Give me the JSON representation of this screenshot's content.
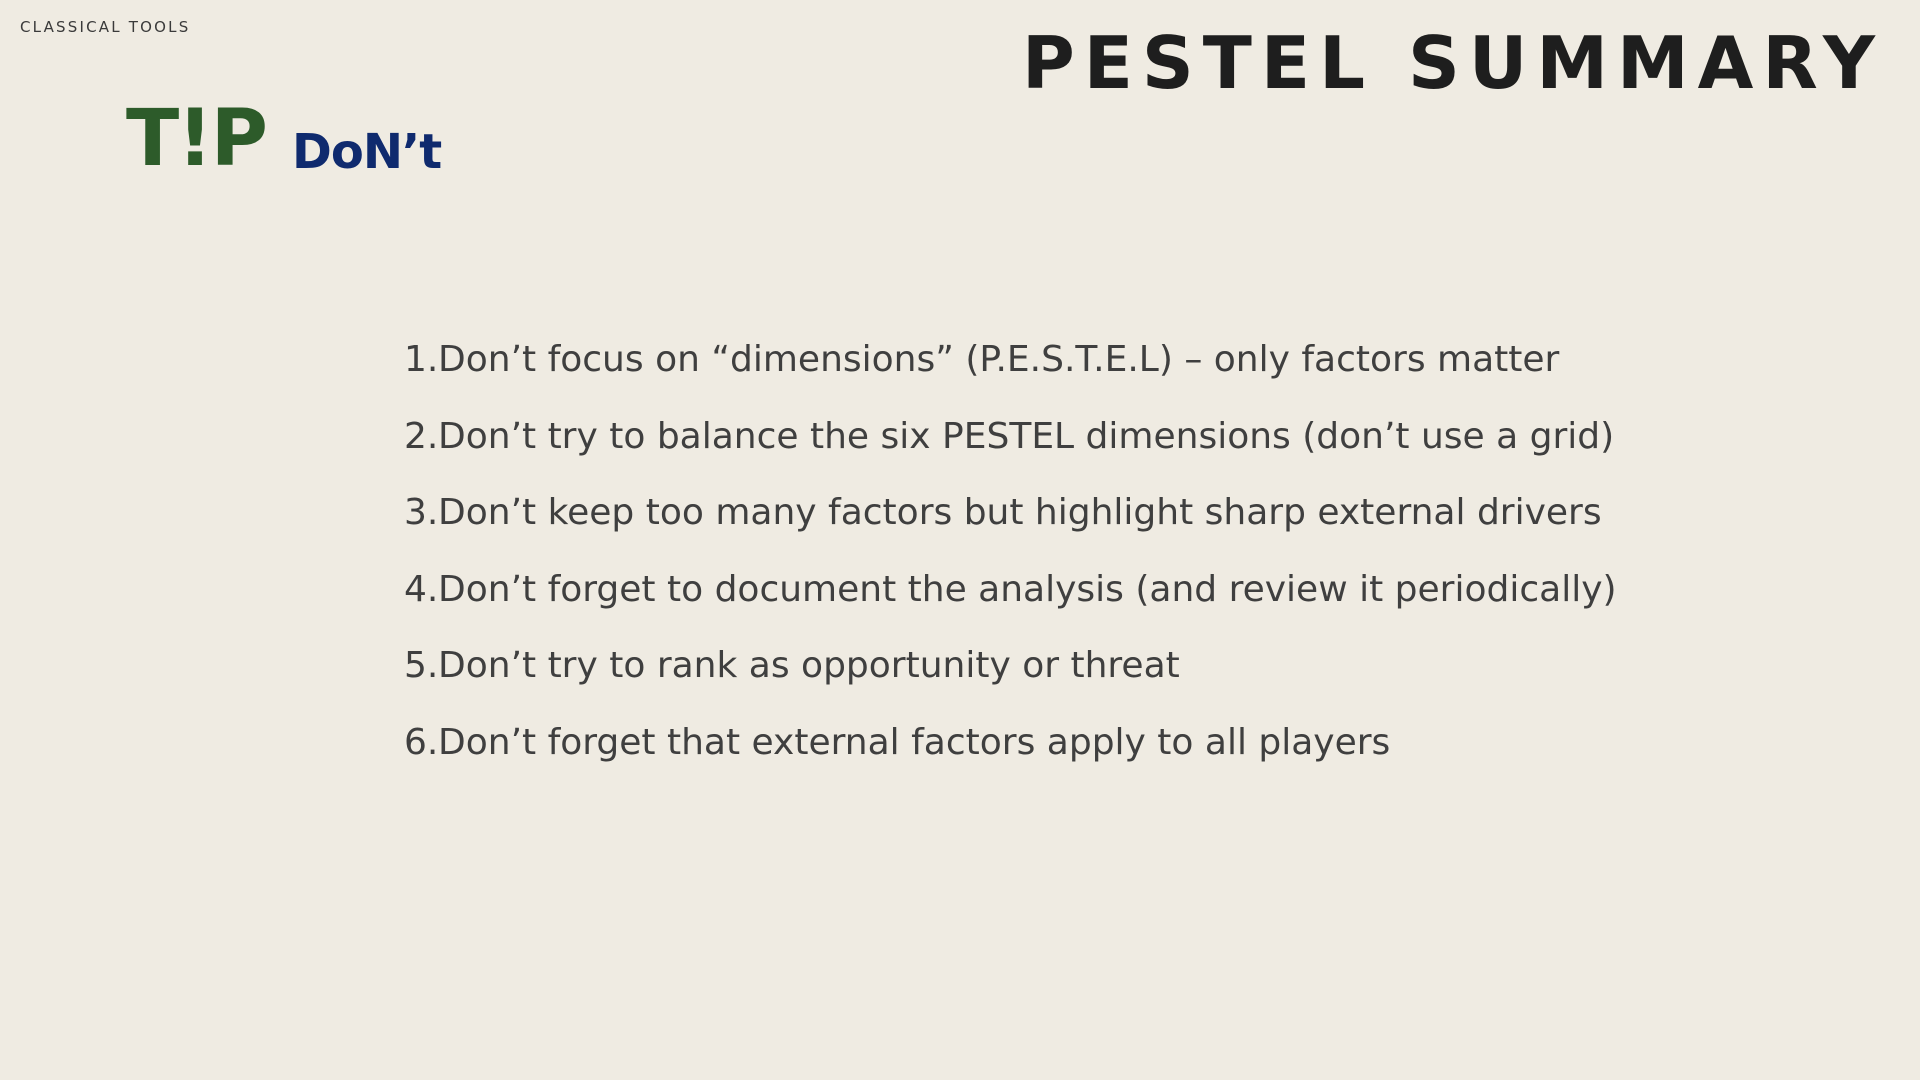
{
  "header": {
    "section_label": "CLASSICAL TOOLS",
    "title": "PESTEL SUMMARY"
  },
  "logo": {
    "tip_text": "T!P",
    "tip_color": "#2d5b2a",
    "dont_text": "DoN’t",
    "dont_color": "#0f2a6e"
  },
  "tips": [
    {
      "number": "1.",
      "text": "Don’t focus on “dimensions” (P.E.S.T.E.L) – only factors matter"
    },
    {
      "number": "2.",
      "text": "Don’t try to balance the six PESTEL dimensions (don’t use a grid)"
    },
    {
      "number": "3.",
      "text": "Don’t keep too many factors but highlight sharp external drivers"
    },
    {
      "number": "4.",
      "text": "Don’t forget to document the analysis (and review it periodically)"
    },
    {
      "number": "5.",
      "text": "Don’t try to rank as opportunity or threat"
    },
    {
      "number": "6.",
      "text": "Don’t forget that external factors apply to all players"
    }
  ]
}
